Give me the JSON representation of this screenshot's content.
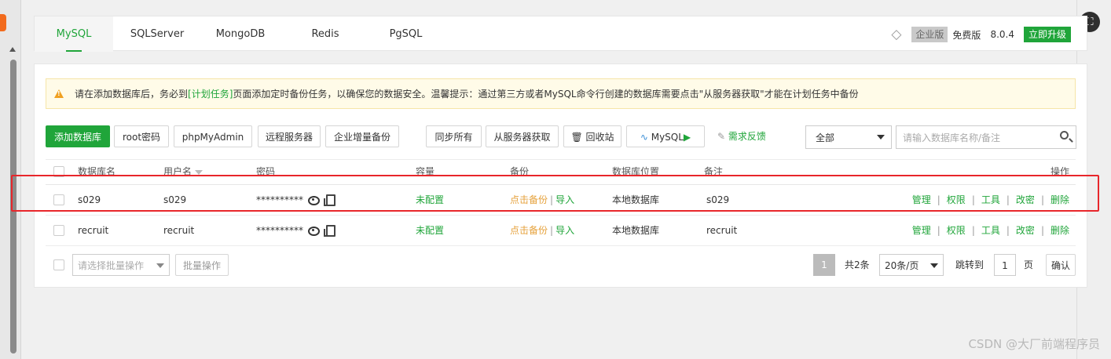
{
  "tabs": [
    {
      "label": "MySQL",
      "active": true
    },
    {
      "label": "SQLServer"
    },
    {
      "label": "MongoDB"
    },
    {
      "label": "Redis"
    },
    {
      "label": "PgSQL"
    }
  ],
  "version": {
    "edition": "企业版",
    "free": "免费版",
    "number": "8.0.4",
    "upgrade": "立即升级"
  },
  "notice": {
    "pre": "请在添加数据库后，务必到",
    "link": "[计划任务]",
    "post": "页面添加定时备份任务，以确保您的数据安全。温馨提示：通过第三方或者MySQL命令行创建的数据库需要点击\"从服务器获取\"才能在计划任务中备份"
  },
  "toolbar": {
    "add_db": "添加数据库",
    "root_pwd": "root密码",
    "phpmyadmin": "phpMyAdmin",
    "remote": "远程服务器",
    "enterprise_backup": "企业增量备份",
    "sync_all": "同步所有",
    "fetch": "从服务器获取",
    "recycle": "回收站",
    "mysql": "MySQL",
    "feedback": "需求反馈",
    "filter_value": "全部",
    "search_placeholder": "请输入数据库名称/备注"
  },
  "table": {
    "headers": {
      "name": "数据库名",
      "user": "用户名",
      "password": "密码",
      "capacity": "容量",
      "backup": "备份",
      "location": "数据库位置",
      "note": "备注",
      "ops": "操作"
    },
    "rows": [
      {
        "name": "s029",
        "user": "s029",
        "password": "**********",
        "capacity": "未配置",
        "backup_link": "点击备份",
        "import_link": "导入",
        "location": "本地数据库",
        "note": "s029",
        "ops": [
          "管理",
          "权限",
          "工具",
          "改密",
          "删除"
        ]
      },
      {
        "name": "recruit",
        "user": "recruit",
        "password": "**********",
        "capacity": "未配置",
        "backup_link": "点击备份",
        "import_link": "导入",
        "location": "本地数据库",
        "note": "recruit",
        "ops": [
          "管理",
          "权限",
          "工具",
          "改密",
          "删除"
        ]
      }
    ]
  },
  "footer": {
    "batch_placeholder": "请选择批量操作",
    "batch_button": "批量操作",
    "page_current": "1",
    "total": "共2条",
    "per_page": "20条/页",
    "goto": "跳转到",
    "goto_value": "1",
    "page_unit": "页",
    "confirm": "确认"
  },
  "watermark": "CSDN @大厂前端程序员",
  "colors": {
    "accent": "#20a53a",
    "warning": "#e6a23c",
    "highlight": "#e8262b"
  }
}
